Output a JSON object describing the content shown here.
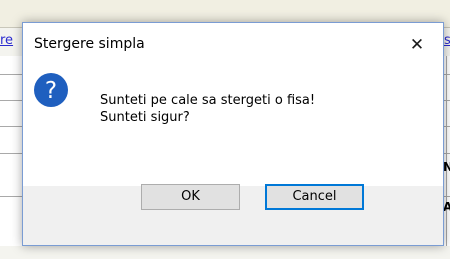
{
  "background": {
    "tab_left_text": "re",
    "tab_right_text": "sp",
    "row_letters": [
      "N",
      "A"
    ]
  },
  "dialog": {
    "title": "Stergere simpla",
    "close_glyph": "✕",
    "icon": "question-icon",
    "icon_glyph": "?",
    "message_lines": [
      "Sunteti pe cale sa stergeti o fisa!",
      "Sunteti sigur?"
    ],
    "buttons": {
      "ok_label": "OK",
      "cancel_label": "Cancel"
    }
  },
  "colors": {
    "icon_blue": "#1f5fbf",
    "focus_border": "#0078d7",
    "footer_bg": "#f0f0f0",
    "link_blue": "#2b2bd0"
  }
}
